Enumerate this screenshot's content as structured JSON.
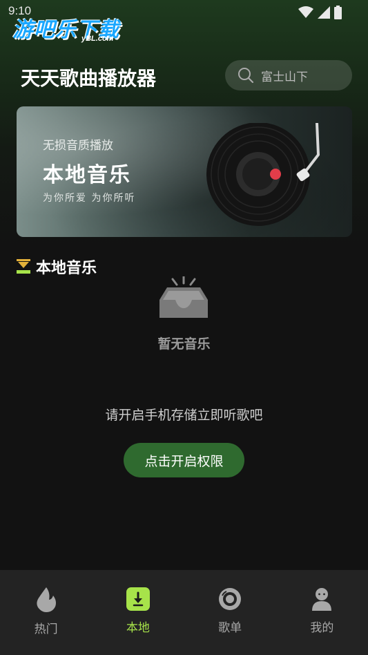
{
  "status_bar": {
    "time": "9:10"
  },
  "watermark": {
    "title": "游吧乐下载",
    "subtitle": "yBL.com"
  },
  "header": {
    "title": "天天歌曲播放器"
  },
  "search": {
    "placeholder": "富士山下",
    "icon": "search-icon"
  },
  "banner": {
    "line1": "无损音质播放",
    "line2": "本地音乐",
    "line3": "为你所爱  为你所听"
  },
  "section": {
    "title": "本地音乐",
    "icon": "download-icon"
  },
  "empty_state": {
    "title": "暂无音乐",
    "hint": "请开启手机存储立即听歌吧",
    "button": "点击开启权限"
  },
  "nav": {
    "active": "本地",
    "items": [
      {
        "label": "热门",
        "icon": "flame-icon"
      },
      {
        "label": "本地",
        "icon": "download-box-icon"
      },
      {
        "label": "歌单",
        "icon": "disc-icon"
      },
      {
        "label": "我的",
        "icon": "user-icon"
      }
    ]
  },
  "colors": {
    "accent": "#a7e34a",
    "button": "#2f6a2f",
    "background": "#121212",
    "nav_bg": "#232323"
  }
}
